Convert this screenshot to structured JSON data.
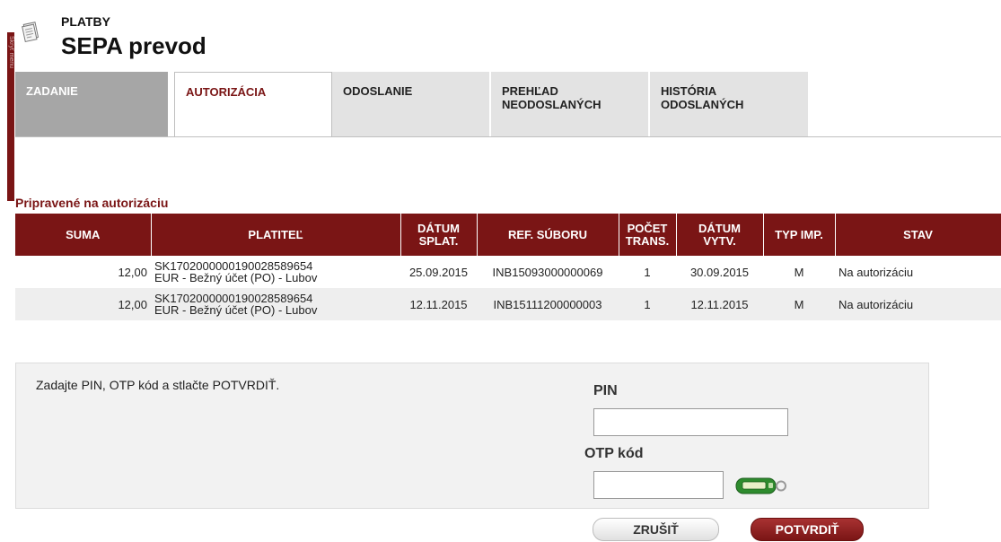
{
  "header": {
    "section": "PLATBY",
    "title": "SEPA prevod",
    "rail_text": "Skryť menu",
    "icon": "document-icon"
  },
  "tabs": [
    {
      "label": "ZADANIE"
    },
    {
      "label": "AUTORIZÁCIA",
      "active": true
    },
    {
      "label": "ODOSLANIE"
    },
    {
      "label": "PREHĽAD NEODOSLANÝCH"
    },
    {
      "label": "HISTÓRIA ODOSLANÝCH"
    }
  ],
  "table": {
    "caption": "Pripravené na autorizáciu",
    "columns": [
      "SUMA",
      "PLATITEĽ",
      "DÁTUM SPLAT.",
      "REF. SÚBORU",
      "POČET TRANS.",
      "DÁTUM VYTV.",
      "TYP IMP.",
      "STAV"
    ],
    "rows": [
      {
        "suma": "12,00",
        "platitel_line1": "SK1702000000190028589654",
        "platitel_line2": "EUR - Bežný účet (PO) - Lubov",
        "datum_splat": "25.09.2015",
        "ref": "INB15093000000069",
        "pocet": "1",
        "datum_vytv": "30.09.2015",
        "typ": "M",
        "stav": "Na autorizáciu"
      },
      {
        "suma": "12,00",
        "platitel_line1": "SK1702000000190028589654",
        "platitel_line2": "EUR - Bežný účet (PO) - Lubov",
        "datum_splat": "12.11.2015",
        "ref": "INB15111200000003",
        "pocet": "1",
        "datum_vytv": "12.11.2015",
        "typ": "M",
        "stav": "Na autorizáciu"
      }
    ]
  },
  "auth": {
    "hint": "Zadajte PIN, OTP kód a stlačte POTVRDIŤ.",
    "pin_label": "PIN",
    "pin_value": "",
    "otp_label": "OTP kód",
    "otp_value": "",
    "token_icon": "otp-token-icon"
  },
  "buttons": {
    "cancel": "ZRUŠIŤ",
    "confirm": "POTVRDIŤ"
  },
  "colors": {
    "brand": "#7a1515",
    "tab_inactive": "#e3e3e3",
    "tab_first": "#a6a6a6",
    "panel": "#f2f2f2",
    "row_alt": "#eeeeee"
  }
}
